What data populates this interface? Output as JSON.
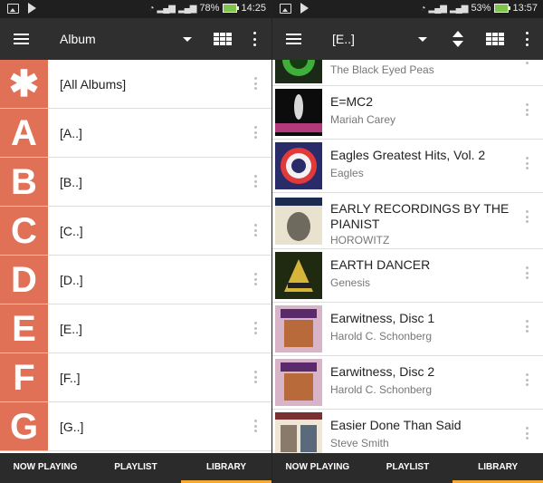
{
  "left": {
    "status": {
      "battery": "78%",
      "time": "14:25"
    },
    "toolbar": {
      "title": "Album"
    },
    "letters": [
      {
        "glyph": "✱",
        "label": "[All Albums]"
      },
      {
        "glyph": "A",
        "label": "[A..]"
      },
      {
        "glyph": "B",
        "label": "[B..]"
      },
      {
        "glyph": "C",
        "label": "[C..]"
      },
      {
        "glyph": "D",
        "label": "[D..]"
      },
      {
        "glyph": "E",
        "label": "[E..]"
      },
      {
        "glyph": "F",
        "label": "[F..]"
      },
      {
        "glyph": "G",
        "label": "[G..]"
      }
    ],
    "nav": {
      "now_playing": "NOW PLAYING",
      "playlist": "PLAYLIST",
      "library": "LIBRARY"
    }
  },
  "right": {
    "status": {
      "battery": "53%",
      "time": "13:57"
    },
    "toolbar": {
      "title": "[E..]"
    },
    "albums": [
      {
        "title": "",
        "artist": "The Black Eyed Peas"
      },
      {
        "title": "E=MC2",
        "artist": "Mariah Carey"
      },
      {
        "title": "Eagles Greatest Hits, Vol. 2",
        "artist": "Eagles"
      },
      {
        "title": "EARLY RECORDINGS BY THE PIANIST",
        "artist": "HOROWITZ"
      },
      {
        "title": "EARTH DANCER",
        "artist": "Genesis"
      },
      {
        "title": "Earwitness, Disc 1",
        "artist": "Harold C. Schonberg"
      },
      {
        "title": "Earwitness, Disc 2",
        "artist": "Harold C. Schonberg"
      },
      {
        "title": "Easier Done Than Said",
        "artist": "Steve Smith"
      }
    ],
    "nav": {
      "now_playing": "NOW PLAYING",
      "playlist": "PLAYLIST",
      "library": "LIBRARY"
    }
  },
  "colors": {
    "letter_tile": "#e07157",
    "toolbar": "#2f2f2f",
    "status_bar": "#1f1f1f",
    "nav_active": "#f4a932"
  }
}
